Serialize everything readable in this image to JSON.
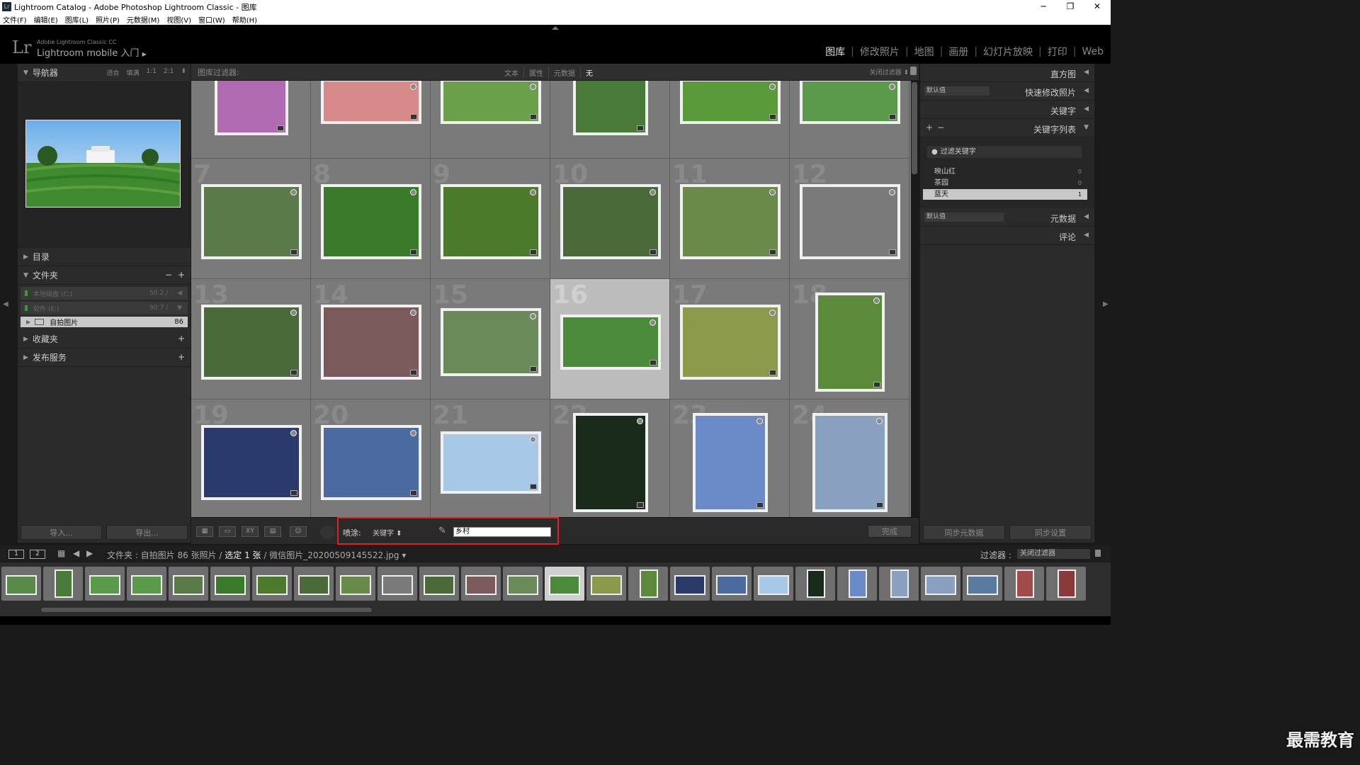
{
  "window": {
    "title": "Lightroom Catalog - Adobe Photoshop Lightroom Classic - 图库",
    "badge": "Lr",
    "controls": [
      "─",
      "❐",
      "✕"
    ]
  },
  "menu": [
    "文件(F)",
    "编辑(E)",
    "图库(L)",
    "照片(P)",
    "元数据(M)",
    "视图(V)",
    "窗口(W)",
    "帮助(H)"
  ],
  "identity": {
    "logo": "Lr",
    "product_small": "Adobe Lightroom Classic CC",
    "product_big": "Lightroom mobile 入门",
    "arrow": "▶"
  },
  "modules": [
    "图库",
    "修改照片",
    "地图",
    "画册",
    "幻灯片放映",
    "打印",
    "Web"
  ],
  "active_module": "图库",
  "left": {
    "navigator": {
      "label": "导航器",
      "options": [
        "适合",
        "填满",
        "1:1",
        "2:1"
      ],
      "arrows": "⬍"
    },
    "catalog": "目录",
    "folders": {
      "label": "文件夹",
      "minus": "−",
      "plus": "+",
      "volumes": [
        {
          "name": "本地磁盘 (C:)",
          "size": "50.2 /",
          "arrow": "◀"
        },
        {
          "name": "软件 (E:)",
          "size": "90.7 /",
          "arrow": "▼"
        }
      ],
      "selected": {
        "name": "自拍图片",
        "count": "86"
      }
    },
    "collections": "收藏夹",
    "publish": "发布服务",
    "import_btn": "导入...",
    "export_btn": "导出..."
  },
  "filter": {
    "label": "图库过滤器:",
    "modes": [
      "文本",
      "属性",
      "元数据",
      "无"
    ],
    "active": "无",
    "right": "关闭过滤器 ⬍"
  },
  "grid": {
    "cells": [
      {
        "n": "",
        "color": "#b06ab0"
      },
      {
        "n": "",
        "color": "#d88a8a"
      },
      {
        "n": "",
        "color": "#6aa04a"
      },
      {
        "n": "",
        "color": "#4a7a3a"
      },
      {
        "n": "",
        "color": "#5a9a3a"
      },
      {
        "n": "",
        "color": "#5a9a4a"
      },
      {
        "n": "7",
        "color": "#5a7a4a"
      },
      {
        "n": "8",
        "color": "#3a7a2a"
      },
      {
        "n": "9",
        "color": "#4a7a2a"
      },
      {
        "n": "10",
        "color": "#4a6a3a"
      },
      {
        "n": "11",
        "color": "#6a8a4a"
      },
      {
        "n": "12",
        "color": "#7a7a7a"
      },
      {
        "n": "13",
        "color": "#4a6a3a"
      },
      {
        "n": "14",
        "color": "#7a5a5a"
      },
      {
        "n": "15",
        "color": "#6a8a5a"
      },
      {
        "n": "16",
        "color": "#4a8a3a"
      },
      {
        "n": "17",
        "color": "#8a9a4a"
      },
      {
        "n": "18",
        "color": "#5a8a3a"
      },
      {
        "n": "19",
        "color": "#2a3a6a"
      },
      {
        "n": "20",
        "color": "#4a6aa0"
      },
      {
        "n": "21",
        "color": "#a8c8e8"
      },
      {
        "n": "22",
        "color": "#1a2a1a"
      },
      {
        "n": "23",
        "color": "#6a8ac8"
      },
      {
        "n": "24",
        "color": "#8aa0c0"
      }
    ]
  },
  "toolbar": {
    "icons": [
      "▦",
      "▭",
      "XY",
      "▤",
      "☺"
    ],
    "spray_label": "喷涂:",
    "spray_target": "关键字 ⬍",
    "brush": "🖌",
    "keyword_value": "乡村",
    "done": "完成"
  },
  "right": {
    "histogram": "直方图",
    "quick_develop": "快速修改照片",
    "preset_default": "默认值",
    "keywording": "关键字",
    "keyword_list": "关键字列表",
    "plus": "+",
    "minus": "−",
    "filter_keywords": "过滤关键字",
    "keywords": [
      {
        "name": "映山红",
        "count": "0"
      },
      {
        "name": "茶园",
        "count": "0"
      },
      {
        "name": "蓝天",
        "count": "1"
      }
    ],
    "metadata": "元数据",
    "comments": "评论",
    "sync_meta": "同步元数据",
    "sync_settings": "同步设置"
  },
  "filmstrip_header": {
    "box1": "1",
    "box2": "2",
    "source": "文件夹 : 自拍图片",
    "count": "86 张照片 /",
    "selected": "选定 1 张",
    "file": "/ 微信图片_20200509145522.jpg ▾",
    "filter_label": "过滤器 :",
    "filter_value": "关闭过滤器"
  },
  "filmstrip": {
    "colors": [
      "#5a8a4a",
      "#4a7a3a",
      "#5a9a4a",
      "#5a9a4a",
      "#5a7a4a",
      "#3a7a2a",
      "#4a7a2a",
      "#4a6a3a",
      "#6a8a4a",
      "#7a7a7a",
      "#4a6a3a",
      "#7a5a5a",
      "#6a8a5a",
      "#4a8a3a",
      "#8a9a4a",
      "#5a8a3a",
      "#2a3a6a",
      "#4a6aa0",
      "#a8c8e8",
      "#1a2a1a",
      "#6a8ac8",
      "#8aa0c0",
      "#8aa0c0",
      "#5a7aa0",
      "#a04a4a",
      "#8a3a3a"
    ],
    "selected_index": 13
  },
  "watermark": "最需教育"
}
